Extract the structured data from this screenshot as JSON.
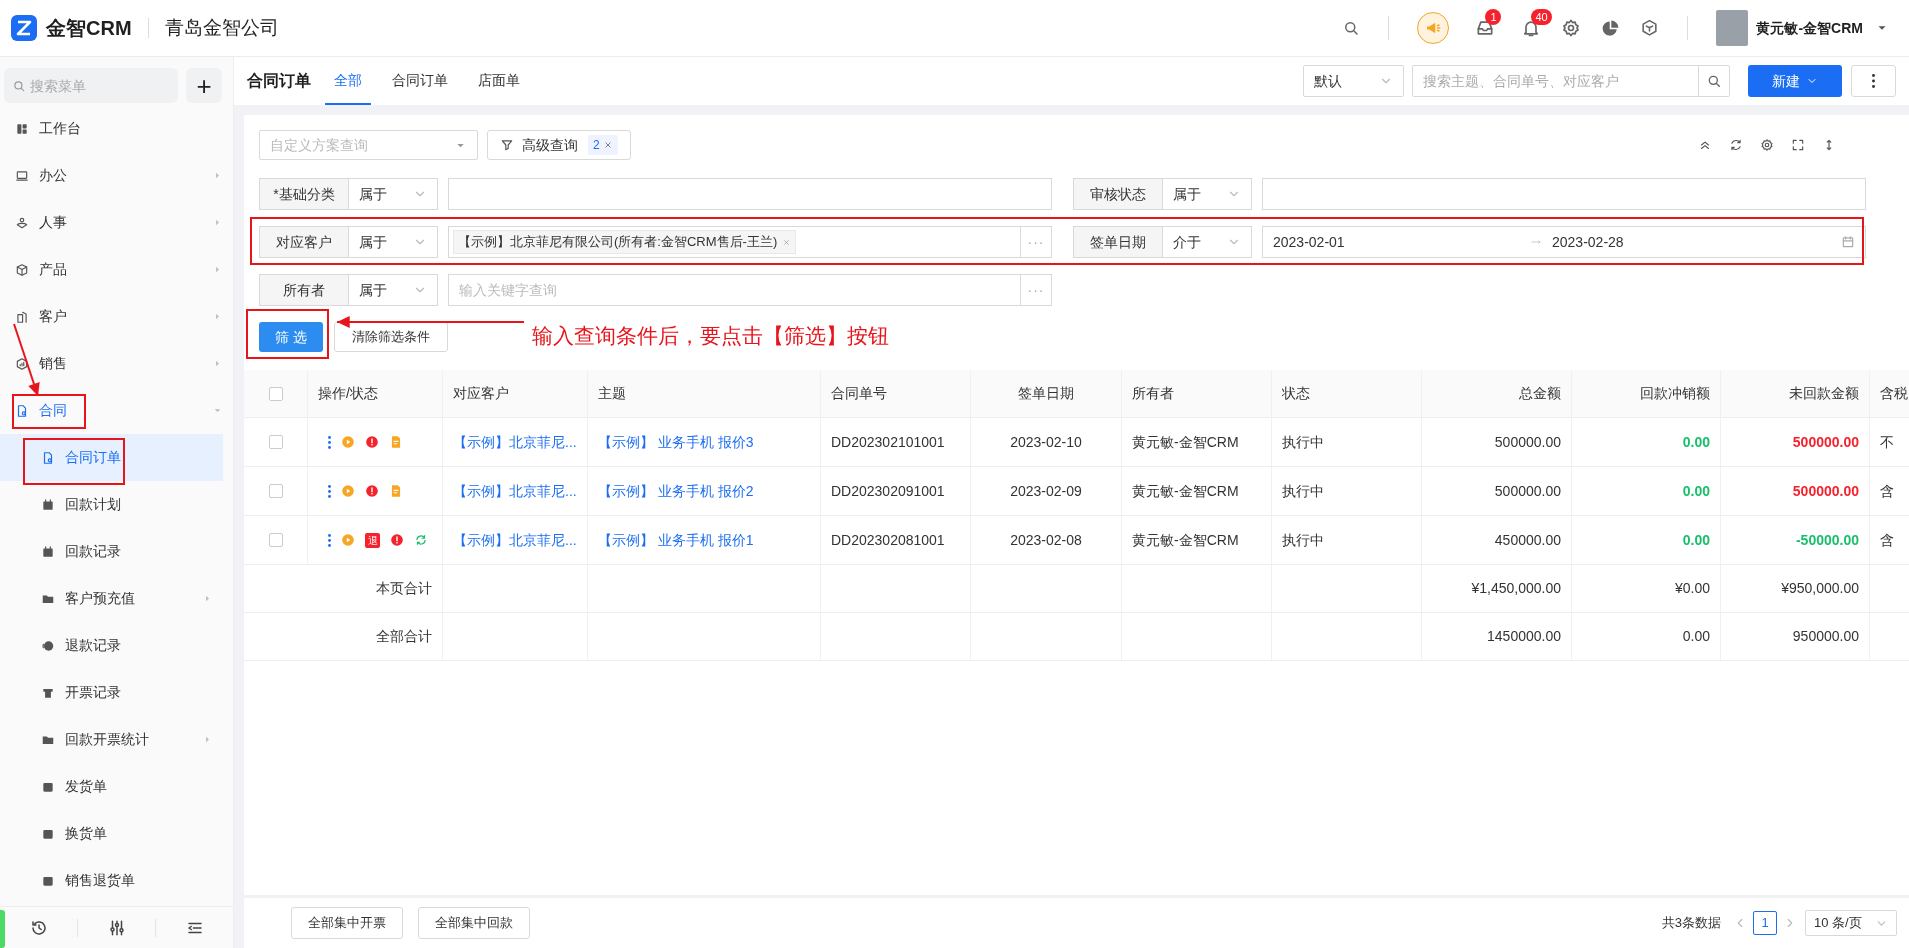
{
  "app": {
    "logo_text": "金智CRM",
    "company": "青岛金智公司",
    "inbox_badge": "1",
    "bell_badge": "40",
    "user": "黄元敏-金智CRM"
  },
  "sidebar": {
    "search_placeholder": "搜索菜单",
    "add_label": "+",
    "items": [
      {
        "label": "工作台",
        "submenu": false,
        "selected": false
      },
      {
        "label": "办公",
        "submenu": true,
        "expanded": false,
        "selected": false
      },
      {
        "label": "人事",
        "submenu": true,
        "expanded": false,
        "selected": false
      },
      {
        "label": "产品",
        "submenu": true,
        "expanded": false,
        "selected": false
      },
      {
        "label": "客户",
        "submenu": true,
        "expanded": false,
        "selected": false
      },
      {
        "label": "销售",
        "submenu": true,
        "expanded": false,
        "selected": false
      },
      {
        "label": "合同",
        "submenu": true,
        "expanded": true,
        "selected": true,
        "children": [
          {
            "label": "合同订单",
            "submenu": false,
            "selected": true
          },
          {
            "label": "回款计划",
            "submenu": false,
            "selected": false
          },
          {
            "label": "回款记录",
            "submenu": false,
            "selected": false
          },
          {
            "label": "客户预充值",
            "submenu": true,
            "selected": false
          },
          {
            "label": "退款记录",
            "submenu": false,
            "selected": false
          },
          {
            "label": "开票记录",
            "submenu": false,
            "selected": false
          },
          {
            "label": "回款开票统计",
            "submenu": true,
            "selected": false
          },
          {
            "label": "发货单",
            "submenu": false,
            "selected": false
          },
          {
            "label": "换货单",
            "submenu": false,
            "selected": false
          },
          {
            "label": "销售退货单",
            "submenu": false,
            "selected": false
          }
        ]
      }
    ]
  },
  "page": {
    "title": "合同订单",
    "tabs": [
      {
        "label": "全部",
        "selected": true
      },
      {
        "label": "合同订单",
        "selected": false
      },
      {
        "label": "店面单",
        "selected": false
      }
    ],
    "sort_select": "默认",
    "search_placeholder": "搜索主题、合同单号、对应客户",
    "new_button": "新建"
  },
  "filters": {
    "scheme_placeholder": "自定义方案查询",
    "advanced_label": "高级查询",
    "advanced_count": "2",
    "conditions": [
      {
        "kind": "input",
        "label": "*基础分类",
        "operator": "属于"
      },
      {
        "kind": "input",
        "label": "审核状态",
        "operator": "属于"
      },
      {
        "kind": "tag",
        "label": "对应客户",
        "operator": "属于",
        "tag": "【示例】北京菲尼有限公司(所有者:金智CRM售后-王兰)",
        "more": "···"
      },
      {
        "kind": "daterange",
        "label": "签单日期",
        "operator": "介于",
        "start": "2023-02-01",
        "end": "2023-02-28"
      },
      {
        "kind": "input",
        "label": "所有者",
        "operator": "属于",
        "placeholder": "输入关键字查询",
        "more": "···"
      }
    ],
    "filter_button": "筛 选",
    "clear_button": "清除筛选条件"
  },
  "annotation": {
    "text": "输入查询条件后，要点击【筛选】按钮"
  },
  "table": {
    "header_checked": false,
    "columns": [
      "操作/状态",
      "对应客户",
      "主题",
      "合同单号",
      "签单日期",
      "所有者",
      "状态",
      "总金额",
      "回款冲销额",
      "未回款金额",
      "含税"
    ],
    "rows": [
      {
        "checked": false,
        "actions": [
          {
            "kind": "more"
          },
          {
            "kind": "play"
          },
          {
            "kind": "alert"
          },
          {
            "kind": "doc"
          }
        ],
        "customer": "【示例】北京菲尼...",
        "subject": "【示例】 业务手机 报价3",
        "number": "DD202302101001",
        "date": "2023-02-10",
        "owner": "黄元敏-金智CRM",
        "status": "执行中",
        "total": "500000.00",
        "received": {
          "text": "0.00",
          "color": "#19be6b"
        },
        "unpaid": {
          "text": "500000.00",
          "color": "#f5222d"
        },
        "tax": "不"
      },
      {
        "checked": false,
        "actions": [
          {
            "kind": "more"
          },
          {
            "kind": "play"
          },
          {
            "kind": "alert"
          },
          {
            "kind": "doc"
          }
        ],
        "customer": "【示例】北京菲尼...",
        "subject": "【示例】 业务手机 报价2",
        "number": "DD202302091001",
        "date": "2023-02-09",
        "owner": "黄元敏-金智CRM",
        "status": "执行中",
        "total": "500000.00",
        "received": {
          "text": "0.00",
          "color": "#19be6b"
        },
        "unpaid": {
          "text": "500000.00",
          "color": "#f5222d"
        },
        "tax": "含"
      },
      {
        "checked": false,
        "actions": [
          {
            "kind": "more"
          },
          {
            "kind": "play"
          },
          {
            "kind": "refund",
            "text": "退"
          },
          {
            "kind": "alert"
          },
          {
            "kind": "recycle"
          }
        ],
        "customer": "【示例】北京菲尼...",
        "subject": "【示例】 业务手机 报价1",
        "number": "DD202302081001",
        "date": "2023-02-08",
        "owner": "黄元敏-金智CRM",
        "status": "执行中",
        "total": "450000.00",
        "received": {
          "text": "0.00",
          "color": "#19be6b"
        },
        "unpaid": {
          "text": "-50000.00",
          "color": "#19be6b"
        },
        "tax": "含"
      }
    ],
    "summaries": [
      {
        "label": "本页合计",
        "total": "¥1,450,000.00",
        "received": "¥0.00",
        "unpaid": "¥950,000.00"
      },
      {
        "label": "全部合计",
        "total": "1450000.00",
        "received": "0.00",
        "unpaid": "950000.00"
      }
    ]
  },
  "footer": {
    "buttons": [
      "全部集中开票",
      "全部集中回款"
    ],
    "count": "共3条数据",
    "pages": [
      {
        "label": "1",
        "selected": true
      }
    ],
    "page_size": "10 条/页"
  }
}
